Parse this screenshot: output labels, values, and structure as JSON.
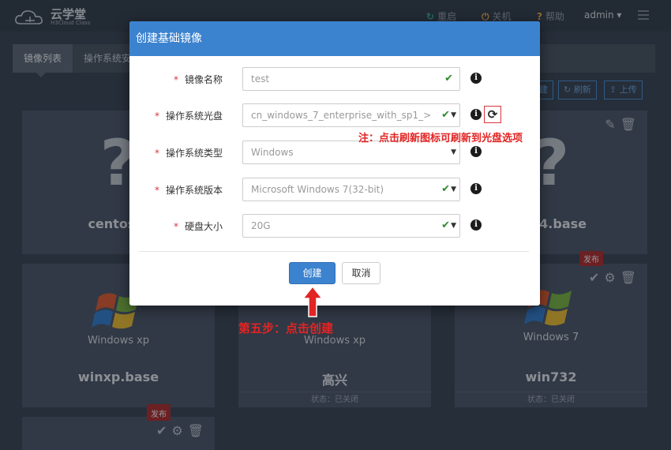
{
  "app": {
    "title": "云学堂",
    "subtitle": "H3Cloud Class"
  },
  "topbar": {
    "restart": "重启",
    "shutdown": "关机",
    "help": "帮助",
    "user": "admin ▾"
  },
  "tabs": [
    "镜像列表",
    "操作系统安"
  ],
  "toolbar": {
    "new": "建",
    "refresh": "刷新",
    "upload": "上传"
  },
  "cards": [
    {
      "name": "centos6.",
      "status": ""
    },
    {
      "name": "tu14.base",
      "status": ""
    },
    {
      "name": "winxp.base",
      "status": "",
      "logo_text": "Windows xp"
    },
    {
      "name": "高兴",
      "status": "状态：已关闭",
      "logo_text": "Windows xp"
    },
    {
      "name": "win732",
      "status": "状态：已关闭",
      "logo_text": "Windows 7"
    },
    {
      "name": "",
      "status": ""
    }
  ],
  "publish_label": "发布",
  "modal": {
    "title": "创建基础镜像",
    "fields": {
      "name": {
        "label": "镜像名称",
        "value": "test"
      },
      "iso": {
        "label": "操作系统光盘",
        "value": "cn_windows_7_enterprise_with_sp1_>"
      },
      "os_type": {
        "label": "操作系统类型",
        "value": "Windows"
      },
      "os_version": {
        "label": "操作系统版本",
        "value": "Microsoft Windows 7(32-bit)"
      },
      "disk": {
        "label": "硬盘大小",
        "value": "20G"
      }
    },
    "create_button": "创建",
    "cancel_button": "取消"
  },
  "annotations": {
    "refresh_note": "注：点击刷新图标可刷新到光盘选项",
    "step5_note": "第五步：点击创建"
  },
  "colors": {
    "primary": "#3c83cf",
    "annotation": "#e32424",
    "valid": "#2e8b2e"
  }
}
